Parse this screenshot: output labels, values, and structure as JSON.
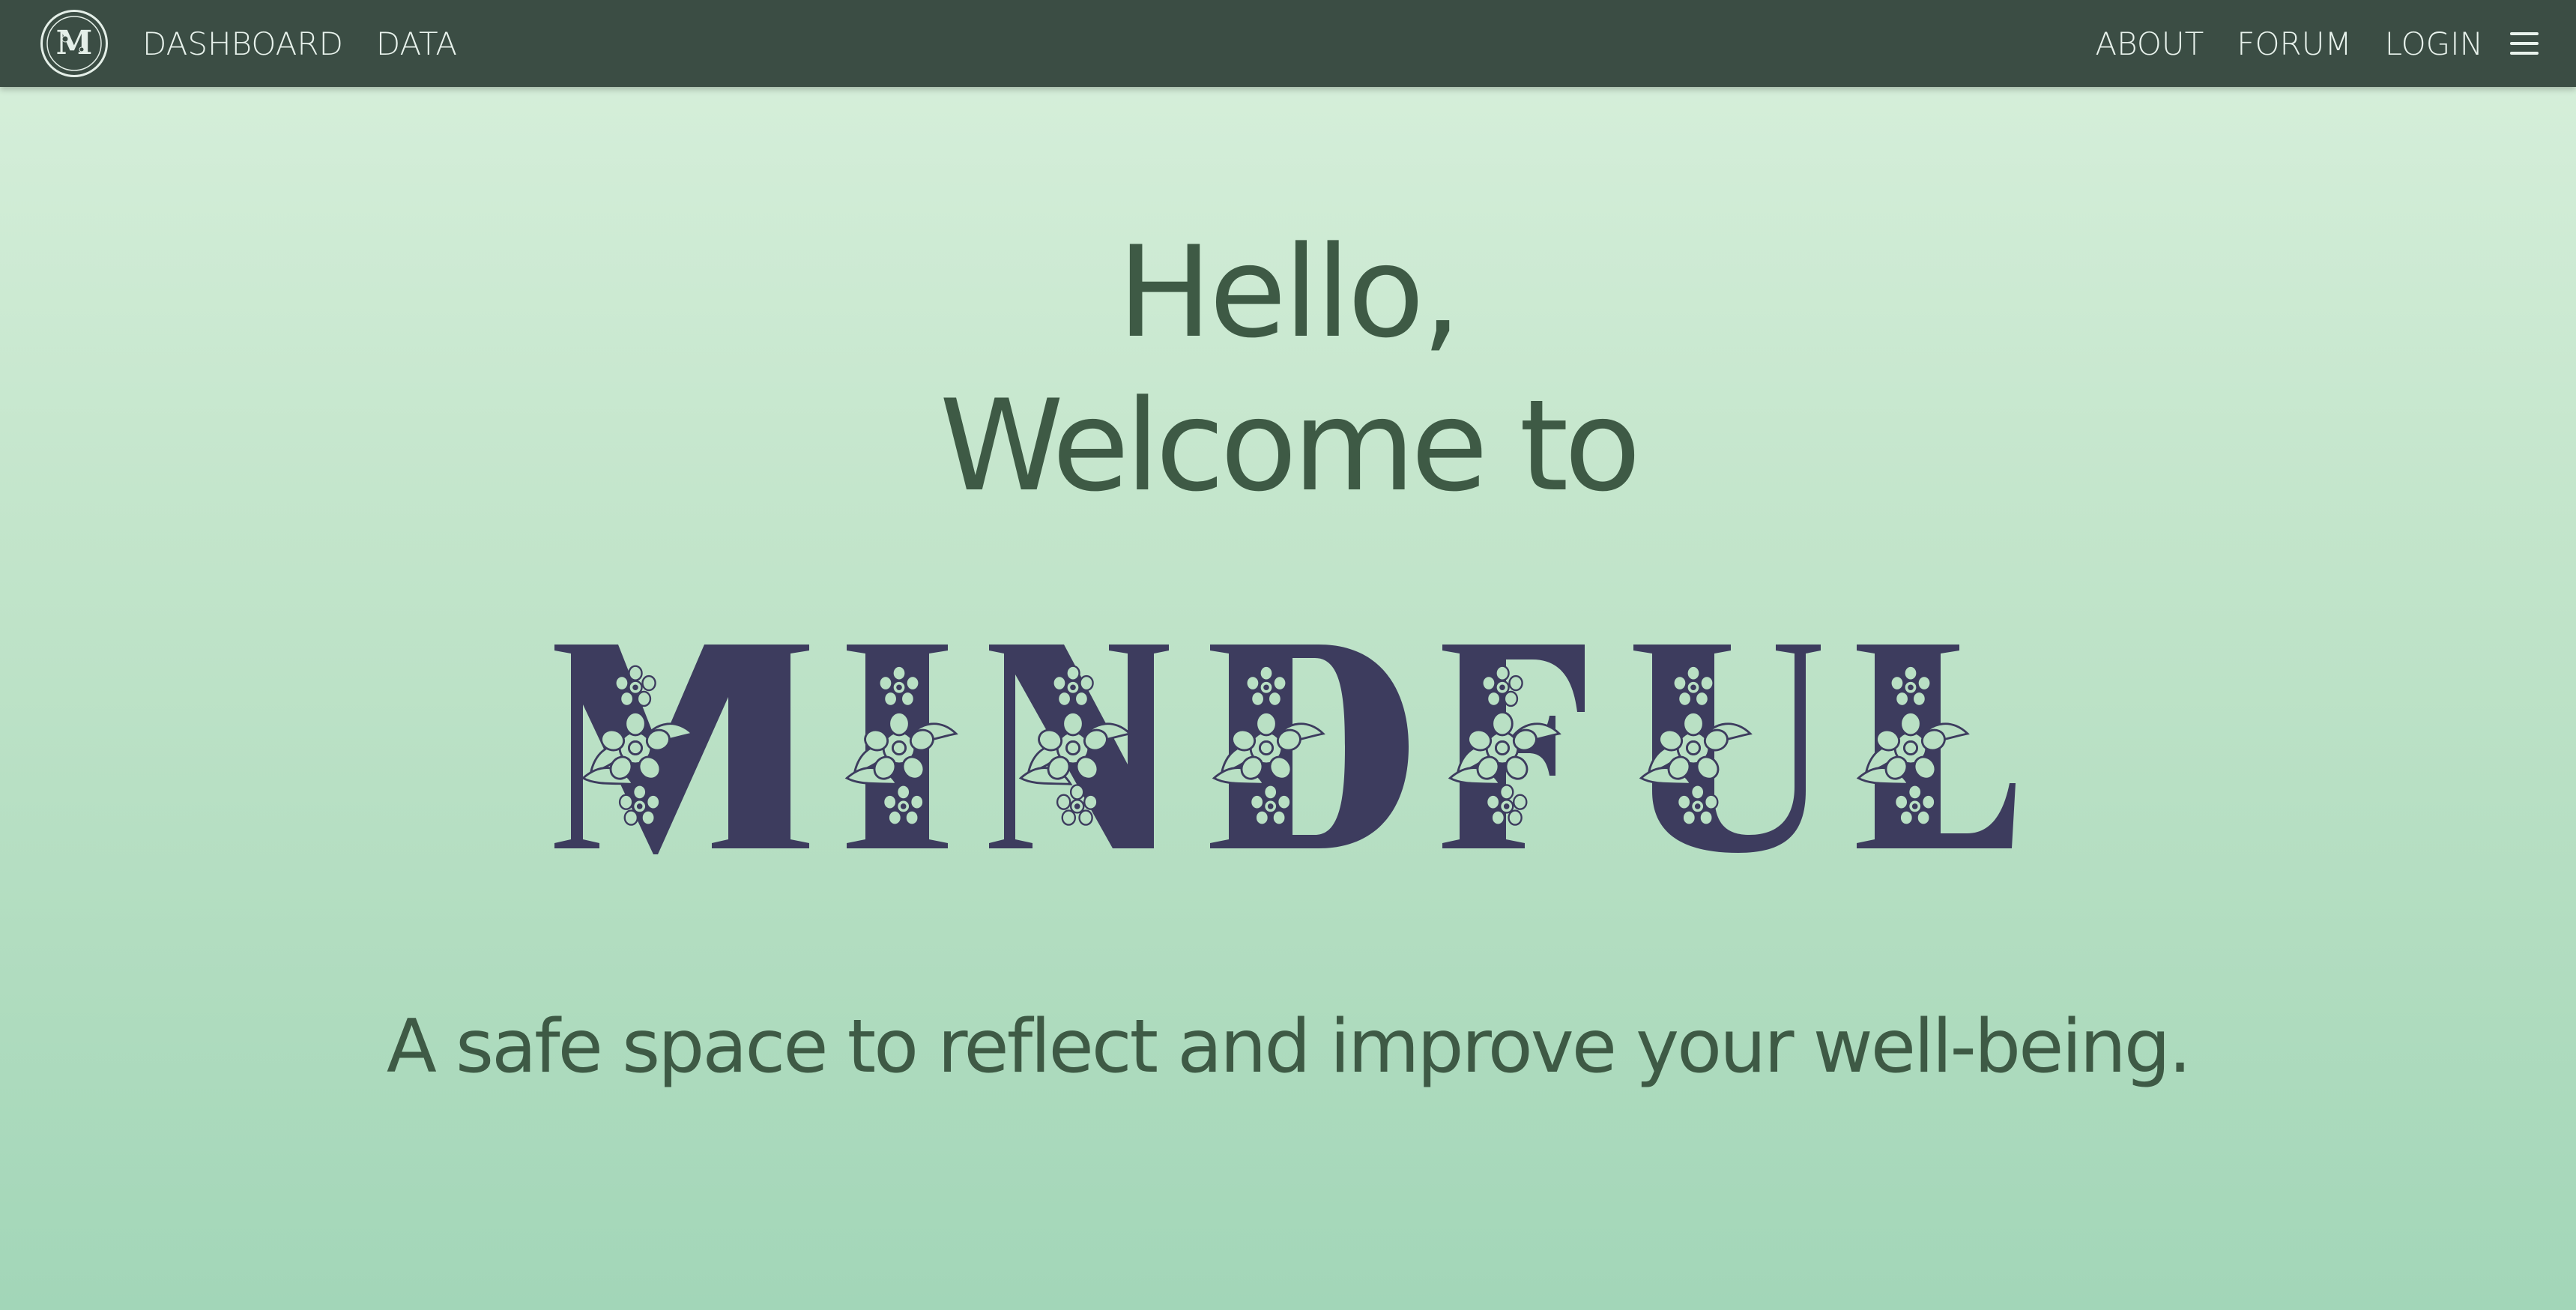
{
  "nav": {
    "logo_letter": "M",
    "left_links": [
      {
        "label": "DASHBOARD"
      },
      {
        "label": "DATA"
      }
    ],
    "right_links": [
      {
        "label": "ABOUT"
      },
      {
        "label": "FORUM"
      },
      {
        "label": "LOGIN"
      }
    ],
    "menu_icon": "hamburger-menu-icon"
  },
  "hero": {
    "greeting_line1": "Hello,",
    "greeting_line2": "Welcome to",
    "brand_name": "MINDFUL",
    "tagline": "A safe space to reflect and improve your well-being."
  },
  "colors": {
    "navbar_bg": "#3b4d44",
    "nav_text": "#e8f2ec",
    "heading_text": "#3e5a45",
    "brand_letters": "#3d3c5e",
    "floral_fill": "#b9e0c4",
    "background_top": "#d8f0dc",
    "background_bottom": "#a2d6b8"
  }
}
